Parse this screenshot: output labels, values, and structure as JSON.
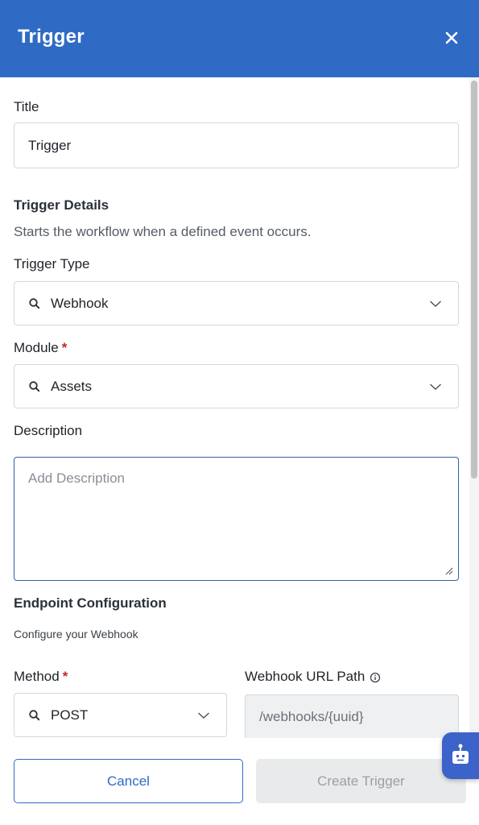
{
  "header": {
    "title": "Trigger",
    "close_icon": "close-icon"
  },
  "form": {
    "title_label": "Title",
    "title_value": "Trigger",
    "details_heading": "Trigger Details",
    "details_helper": "Starts the workflow when a defined event occurs.",
    "trigger_type_label": "Trigger Type",
    "trigger_type_value": "Webhook",
    "module_label": "Module",
    "module_value": "Assets",
    "required_mark": "*",
    "description_label": "Description",
    "description_placeholder": "Add Description",
    "endpoint_heading": "Endpoint Configuration",
    "endpoint_helper": "Configure your Webhook",
    "method_label": "Method",
    "method_value": "POST",
    "url_path_label": "Webhook URL Path",
    "url_path_value": "/webhooks/{uuid}"
  },
  "footer": {
    "cancel_label": "Cancel",
    "create_label": "Create Trigger"
  },
  "colors": {
    "header": "#2f6bc4",
    "accent": "#2f6bc4",
    "required": "#c0282b"
  },
  "icons": [
    "close-icon",
    "search-icon",
    "chevron-down-icon",
    "resize-handle-icon",
    "info-icon",
    "assistant-bot-icon"
  ]
}
